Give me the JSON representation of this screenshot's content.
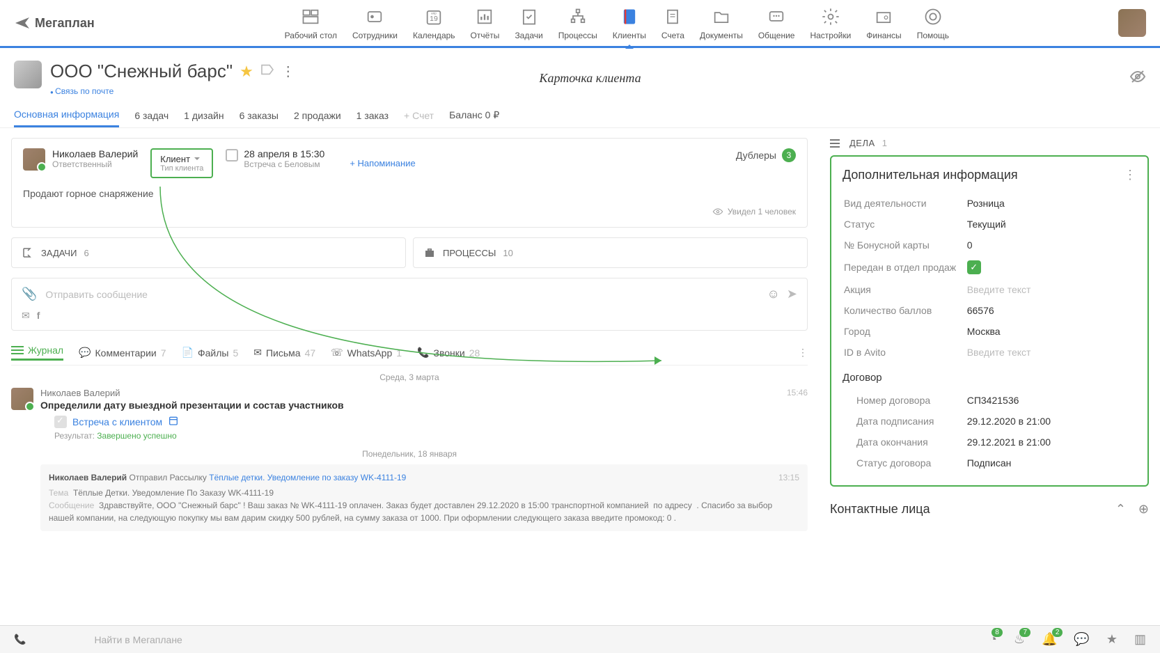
{
  "logo_text": "Мегаплан",
  "nav": [
    {
      "label": "Рабочий стол"
    },
    {
      "label": "Сотрудники"
    },
    {
      "label": "Календарь"
    },
    {
      "label": "Отчёты"
    },
    {
      "label": "Задачи"
    },
    {
      "label": "Процессы"
    },
    {
      "label": "Клиенты"
    },
    {
      "label": "Счета"
    },
    {
      "label": "Документы"
    },
    {
      "label": "Общение"
    },
    {
      "label": "Настройки"
    },
    {
      "label": "Финансы"
    },
    {
      "label": "Помощь"
    }
  ],
  "client": {
    "name": "ООО \"Снежный барс\"",
    "contact_link": "Связь по почте",
    "header_note": "Карточка клиента"
  },
  "tabs": {
    "main": "Основная информация",
    "tasks": "6 задач",
    "design": "1 дизайн",
    "orders": "6 заказы",
    "sales": "2 продажи",
    "order1": "1 заказ",
    "invoice": "+ Счет",
    "balance": "Баланс 0 ₽"
  },
  "card": {
    "responsible_name": "Николаев Валерий",
    "responsible_role": "Ответственный",
    "client_type": "Клиент",
    "client_type_sub": "Тип клиента",
    "meeting_date": "28 апреля в 15:30",
    "meeting_desc": "Встреча с Беловым",
    "reminder": "+ Напоминание",
    "doublers_label": "Дублеры",
    "doublers_count": "3",
    "description": "Продают горное снаряжение",
    "seen_label": "Увидел 1 человек"
  },
  "tasks_box": {
    "label": "ЗАДАЧИ",
    "count": "6"
  },
  "processes_box": {
    "label": "ПРОЦЕССЫ",
    "count": "10"
  },
  "compose_placeholder": "Отправить сообщение",
  "activity_tabs": {
    "journal": "Журнал",
    "comments": "Комментарии",
    "comments_n": "7",
    "files": "Файлы",
    "files_n": "5",
    "letters": "Письма",
    "letters_n": "47",
    "whatsapp": "WhatsApp",
    "whatsapp_n": "1",
    "calls": "Звонки",
    "calls_n": "28"
  },
  "journal": {
    "date1": "Среда, 3 марта",
    "entry1": {
      "name": "Николаев Валерий",
      "time": "15:46",
      "title": "Определили дату выездной презентации и состав участников",
      "meeting_label": "Встреча с клиентом",
      "result_label": "Результат:",
      "result_value": "Завершено успешно"
    },
    "date2": "Понедельник, 18 января",
    "mail": {
      "time": "13:15",
      "author": "Николаев Валерий",
      "action": "Отправил Рассылку",
      "link": "Тёплые детки. Уведомление по заказу WK-4111-19",
      "subject_label": "Тема",
      "subject": "Тёплые Детки. Уведомление По Заказу WK-4111-19",
      "body_label": "Сообщение",
      "body": "Здравствуйте,&nbsp;ООО \"Снежный барс\"&nbsp;! Ваш заказ №&nbsp;WK-4111-19&nbsp;оплачен. Заказ будет доставлен&nbsp;29.12.2020&nbsp;в&nbsp;15:00&nbsp;транспортной компанией&nbsp;&nbsp;по адресу&nbsp;&nbsp;. Спасибо за выбор нашей компании, на следующую покупку мы вам дарим скидку 500 рублей, на сумму заказа от 1000. При оформлении следующего заказа введите промокод:&nbsp;0&nbsp;."
    }
  },
  "deals": {
    "label": "ДЕЛА",
    "count": "1"
  },
  "extra_info": {
    "title": "Дополнительная информация",
    "activity_type_k": "Вид деятельности",
    "activity_type_v": "Розница",
    "status_k": "Статус",
    "status_v": "Текущий",
    "bonus_k": "№ Бонусной карты",
    "bonus_v": "0",
    "transfer_k": "Передан в отдел продаж",
    "action_k": "Акция",
    "action_ph": "Введите текст",
    "points_k": "Количество баллов",
    "points_v": "66576",
    "city_k": "Город",
    "city_v": "Москва",
    "avito_k": "ID в Avito",
    "avito_ph": "Введите текст",
    "contract_header": "Договор",
    "contract_no_k": "Номер договора",
    "contract_no_v": "СП3421536",
    "sign_date_k": "Дата подписания",
    "sign_date_v": "29.12.2020 в 21:00",
    "end_date_k": "Дата окончания",
    "end_date_v": "29.12.2021 в 21:00",
    "contract_status_k": "Статус договора",
    "contract_status_v": "Подписан"
  },
  "contacts_title": "Контактные лица",
  "search_placeholder": "Найти в Мегаплане",
  "bottom_badges": {
    "energy": "8",
    "fire": "7",
    "bell": "2"
  }
}
